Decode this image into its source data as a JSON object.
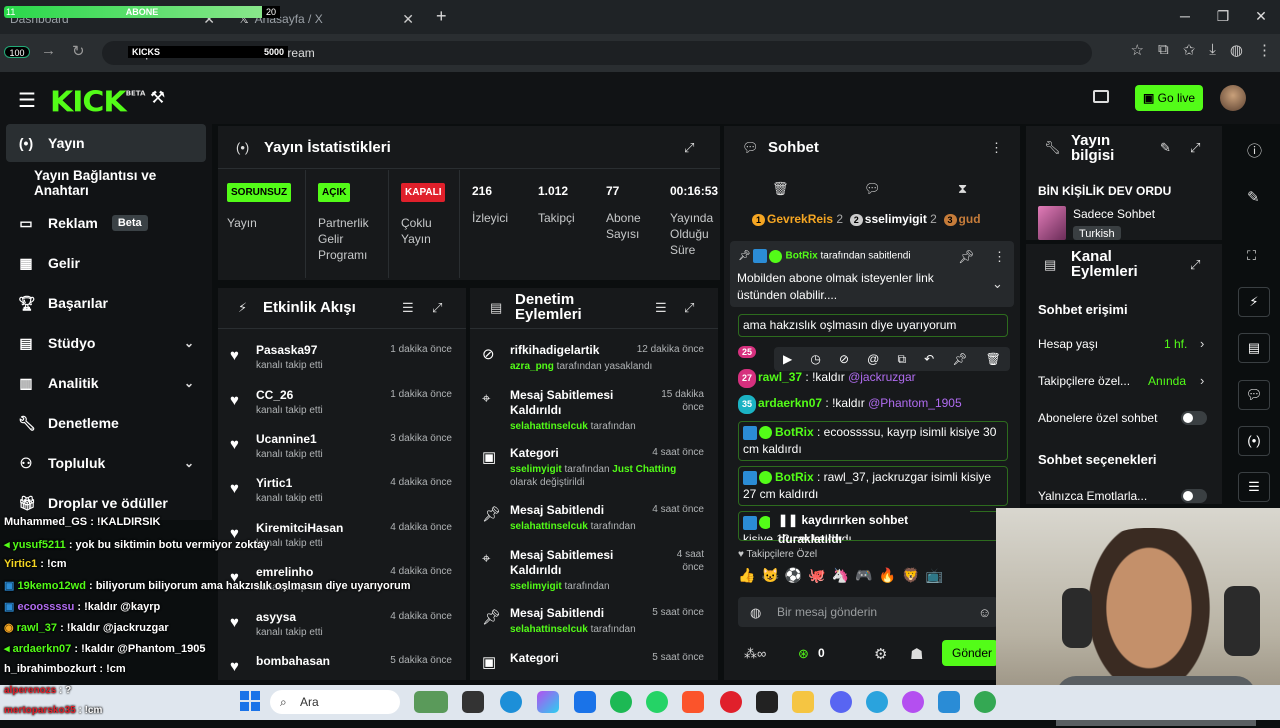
{
  "browser": {
    "tabs": [
      {
        "label": "Dashboard"
      },
      {
        "label": "Anasayfa / X"
      }
    ],
    "url": "https://dashboard.kick.com/stream",
    "overlay": {
      "sub_label": "ABONE",
      "sub_count": "20",
      "follow_count": "100",
      "kicks_label": "KICKS",
      "kicks_count": "5000",
      "left_count": "11"
    }
  },
  "header": {
    "logo": "KICK",
    "logo_sup": "BETA",
    "go_live": "Go live"
  },
  "sidebar": {
    "items": [
      {
        "label": "Yayın",
        "icon": "broadcast-icon"
      },
      {
        "label": "Yayın Bağlantısı ve Anahtarı"
      },
      {
        "label": "Reklam",
        "badge": "Beta",
        "icon": "ad-icon"
      },
      {
        "label": "Gelir",
        "icon": "revenue-icon"
      },
      {
        "label": "Başarılar",
        "icon": "trophy-icon"
      },
      {
        "label": "Stüdyo",
        "icon": "studio-icon"
      },
      {
        "label": "Analitik",
        "icon": "analytics-icon"
      },
      {
        "label": "Denetleme",
        "icon": "wrench-icon"
      },
      {
        "label": "Topluluk",
        "icon": "community-icon"
      },
      {
        "label": "Droplar ve ödüller",
        "icon": "drops-icon"
      }
    ]
  },
  "stats": {
    "title": "Yayın İstatistikleri",
    "items": [
      {
        "badge": "SORUNSUZ",
        "label": "Yayın",
        "color": "#53fc18"
      },
      {
        "badge": "AÇIK",
        "label": "Partnerlik Gelir Programı",
        "color": "#53fc18"
      },
      {
        "badge": "KAPALI",
        "label": "Çoklu Yayın",
        "color": "#e0202b"
      }
    ],
    "numbers": [
      {
        "value": "216",
        "label": "İzleyici"
      },
      {
        "value": "1.012",
        "label": "Takipçi"
      },
      {
        "value": "77",
        "label": "Abone Sayısı"
      },
      {
        "value": "00:16:53",
        "label": "Yayında Olduğu Süre"
      }
    ]
  },
  "activity": {
    "title": "Etkinlik Akışı",
    "items": [
      {
        "name": "Pasaska97",
        "sub": "kanalı takip etti",
        "time": "1 dakika önce"
      },
      {
        "name": "CC_26",
        "sub": "kanalı takip etti",
        "time": "1 dakika önce"
      },
      {
        "name": "Ucannine1",
        "sub": "kanalı takip etti",
        "time": "3 dakika önce"
      },
      {
        "name": "Yirtic1",
        "sub": "kanalı takip etti",
        "time": "4 dakika önce"
      },
      {
        "name": "KiremitciHasan",
        "sub": "kanalı takip etti",
        "time": "4 dakika önce"
      },
      {
        "name": "emrelinho",
        "sub": "kanalı takip etti",
        "time": "4 dakika önce"
      },
      {
        "name": "asyysa",
        "sub": "kanalı takip etti",
        "time": "4 dakika önce"
      },
      {
        "name": "bombahasan",
        "sub": "",
        "time": "5 dakika önce"
      }
    ]
  },
  "moderation": {
    "title": "Denetim Eylemleri",
    "items": [
      {
        "title": "rifkihadigelartik",
        "who": "azra_png",
        "rest": " tarafından yasaklandı",
        "time": "12 dakika önce"
      },
      {
        "title": "Mesaj Sabitlemesi Kaldırıldı",
        "who": "selahattinselcuk",
        "rest": " tarafından",
        "time": "15 dakika önce"
      },
      {
        "title": "Kategori",
        "who": "sselimyigit",
        "rest": " tarafından ",
        "who2": "Just Chatting",
        "rest2": " olarak değiştirildi",
        "time": "4 saat önce"
      },
      {
        "title": "Mesaj Sabitlendi",
        "who": "selahattinselcuk",
        "rest": " tarafından",
        "time": "4 saat önce"
      },
      {
        "title": "Mesaj Sabitlemesi Kaldırıldı",
        "who": "sselimyigit",
        "rest": " tarafından",
        "time": "4 saat önce"
      },
      {
        "title": "Mesaj Sabitlendi",
        "who": "selahattinselcuk",
        "rest": " tarafından",
        "time": "5 saat önce"
      },
      {
        "title": "Kategori",
        "who": "",
        "rest": "",
        "time": "5 saat önce"
      }
    ]
  },
  "chat": {
    "title": "Sohbet",
    "top_gifters": [
      {
        "rank": "1",
        "name": "GevrekReis",
        "count": "2"
      },
      {
        "rank": "2",
        "name": "sselimyigit",
        "count": "2"
      },
      {
        "rank": "3",
        "name": "gud",
        "count": ""
      }
    ],
    "pinned": {
      "by": "BotRix",
      "by_suffix": " tarafından sabitlendi",
      "text": "Mobilden abone olmak isteyenler link üstünden olabilir...."
    },
    "messages": [
      {
        "text": "ama hakzıslık oşlmasın diye uyarıyorum"
      },
      {
        "badge": "27",
        "user": "rawl_37",
        "text": " : !kaldır ",
        "mention": "@jackruzgar"
      },
      {
        "badge": "35",
        "user": "ardaerkn07",
        "text": " : !kaldır ",
        "mention": "@Phantom_1905"
      },
      {
        "user": "BotRix",
        "text": " : ecoossssu, kayrp isimli kisiye 30 cm kaldırdı"
      },
      {
        "user": "BotRix",
        "text": " : rawl_37, jackruzgar isimli kisiye 27 cm kaldırdı"
      },
      {
        "paused": "kaydırırken sohbet duraklatıldı",
        "text": "kisiye 12 cm kaldırdı"
      }
    ],
    "followers_only": "Takipçilere Özel",
    "placeholder": "Bir mesaj gönderin",
    "count": "0",
    "send": "Gönder"
  },
  "stream_info": {
    "title": "Yayın bilgisi",
    "stream_title": "BİN KİŞİLİK DEV ORDU",
    "category": "Sadece Sohbet",
    "language": "Turkish"
  },
  "channel_actions": {
    "title": "Kanal Eylemleri",
    "chat_access": "Sohbet erişimi",
    "account_age": {
      "label": "Hesap yaşı",
      "value": "1 hf."
    },
    "followers": {
      "label": "Takipçilere özel...",
      "value": "Anında"
    },
    "subs_only": "Abonelere özel sohbet",
    "chat_options": "Sohbet seçenekleri",
    "emotes_only": "Yalnızca Emotlarla..."
  },
  "overlay_chat": [
    {
      "user": "Muhammed_GS",
      "text": " : !KALDIRSIK"
    },
    {
      "user": "yusuf5211",
      "text": " : yok bu siktimin botu vermiyor zoktay"
    },
    {
      "user": "Yirtic1",
      "text": " : !cm"
    },
    {
      "user": "19kemo12wd",
      "text": " : biliyorum biliyorum ama hakzıslık oşlmasın diye uyarıyorum"
    },
    {
      "user": "ecoossssu",
      "text": " : !kaldır @kayrp"
    },
    {
      "user": "rawl_37",
      "text": " : !kaldır @jackruzgar"
    },
    {
      "user": "ardaerkn07",
      "text": " : !kaldır @Phantom_1905"
    },
    {
      "user": "h_ibrahimbozkurt",
      "text": " : !cm"
    },
    {
      "user": "alperenozs",
      "text": " : ?"
    },
    {
      "user": "mertoparsko35",
      "text": " : !cm"
    }
  ],
  "taskbar": {
    "search": "Ara"
  }
}
